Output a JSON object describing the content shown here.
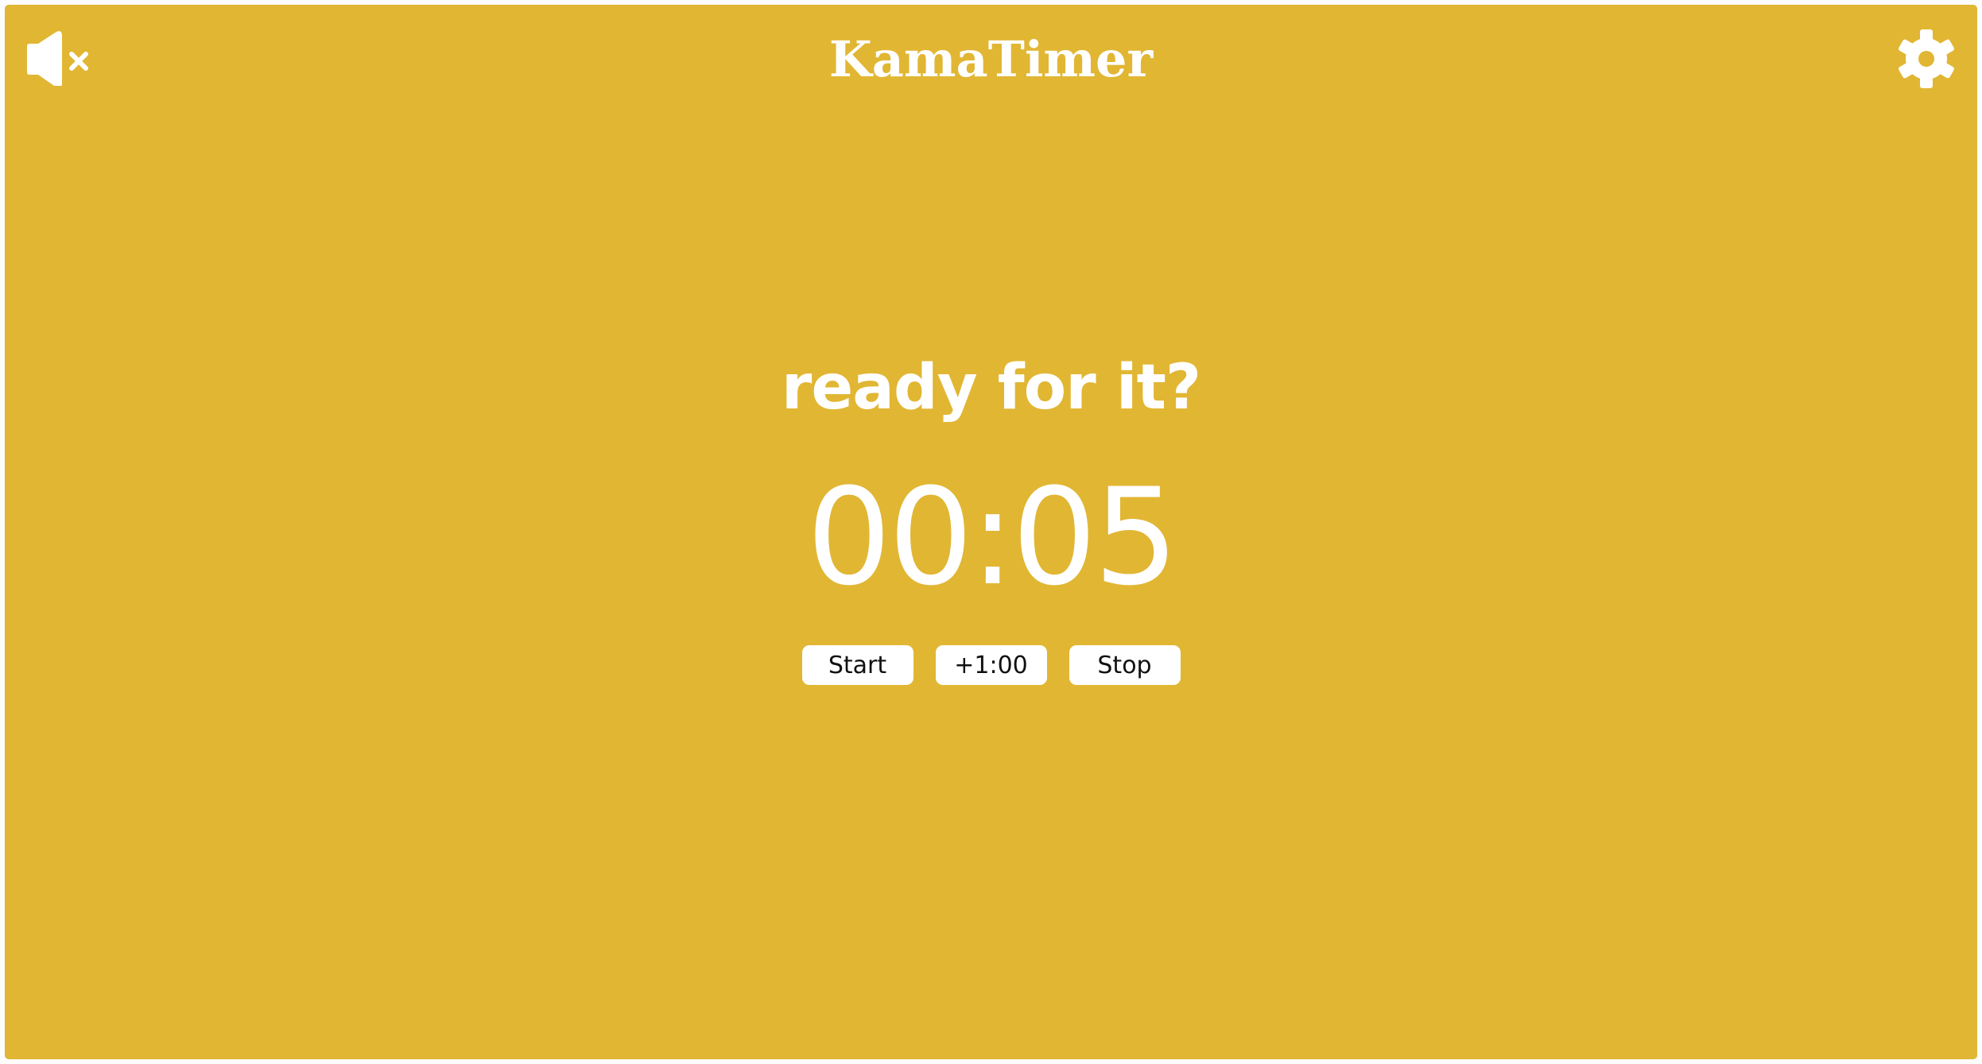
{
  "app": {
    "title": "KamaTimer",
    "background_color": "#e1b633",
    "foreground_color": "#ffffff"
  },
  "header": {
    "mute_icon": "speaker-muted-icon",
    "settings_icon": "gear-icon"
  },
  "timer": {
    "status": "ready for it?",
    "time": "00:05"
  },
  "controls": {
    "start_label": "Start",
    "add_minute_label": "+1:00",
    "stop_label": "Stop"
  }
}
